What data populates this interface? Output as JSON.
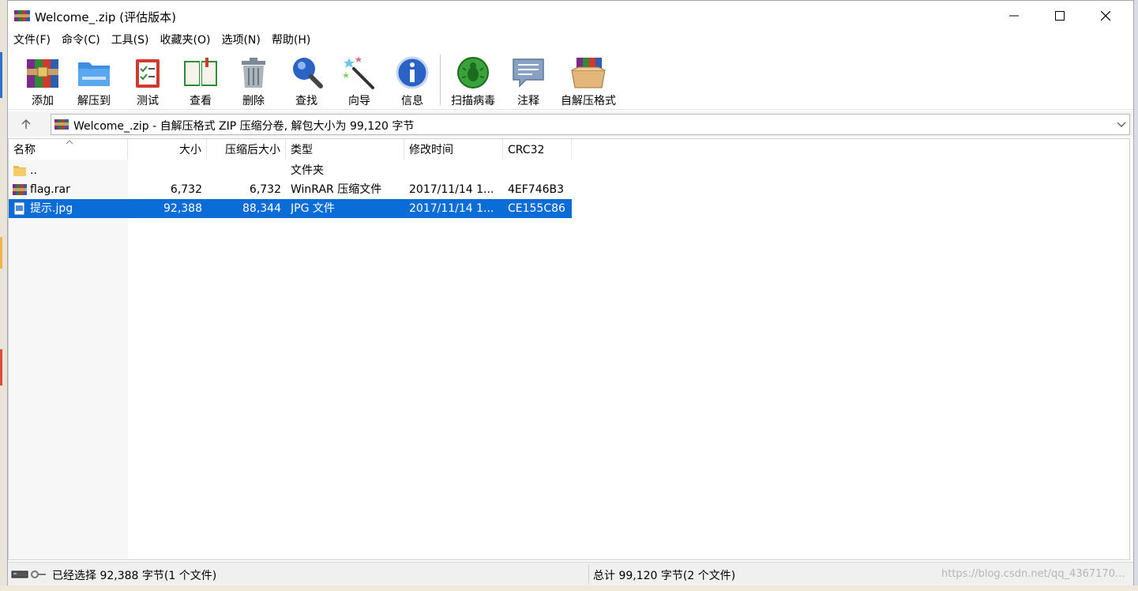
{
  "window": {
    "title": "Welcome_.zip (评估版本)"
  },
  "menu": [
    {
      "label": "文件(F)"
    },
    {
      "label": "命令(C)"
    },
    {
      "label": "工具(S)"
    },
    {
      "label": "收藏夹(O)"
    },
    {
      "label": "选项(N)"
    },
    {
      "label": "帮助(H)"
    }
  ],
  "toolbar": [
    {
      "label": "添加",
      "icon": "add-archive-icon"
    },
    {
      "label": "解压到",
      "icon": "extract-to-icon"
    },
    {
      "label": "测试",
      "icon": "test-clipboard-icon"
    },
    {
      "label": "查看",
      "icon": "view-book-icon"
    },
    {
      "label": "删除",
      "icon": "trash-icon"
    },
    {
      "label": "查找",
      "icon": "magnifier-icon"
    },
    {
      "label": "向导",
      "icon": "wizard-wand-icon"
    },
    {
      "label": "信息",
      "icon": "info-icon"
    },
    {
      "label": "扫描病毒",
      "icon": "virus-scan-icon"
    },
    {
      "label": "注释",
      "icon": "comment-icon"
    },
    {
      "label": "自解压格式",
      "icon": "sfx-box-icon"
    }
  ],
  "address": {
    "path": "Welcome_.zip - 自解压格式 ZIP 压缩分卷, 解包大小为 99,120 字节"
  },
  "columns": {
    "name": "名称",
    "size": "大小",
    "packed": "压缩后大小",
    "type": "类型",
    "modified": "修改时间",
    "crc": "CRC32"
  },
  "files": [
    {
      "name": "..",
      "size": "",
      "packed": "",
      "type": "文件夹",
      "modified": "",
      "crc": "",
      "icon": "folder-icon",
      "selected": false
    },
    {
      "name": "flag.rar",
      "size": "6,732",
      "packed": "6,732",
      "type": "WinRAR 压缩文件",
      "modified": "2017/11/14 1...",
      "crc": "4EF746B3",
      "icon": "rar-file-icon",
      "selected": false
    },
    {
      "name": "提示.jpg",
      "size": "92,388",
      "packed": "88,344",
      "type": "JPG 文件",
      "modified": "2017/11/14 1...",
      "crc": "CE155C86",
      "icon": "jpg-file-icon",
      "selected": true
    }
  ],
  "status": {
    "left": "已经选择 92,388 字节(1 个文件)",
    "right": "总计 99,120 字节(2 个文件)",
    "watermark": "https://blog.csdn.net/qq_4367170..."
  },
  "colors": {
    "selection": "#0a6cd6",
    "window_bg": "#ffffff",
    "status_bg": "#f0f0f0"
  }
}
